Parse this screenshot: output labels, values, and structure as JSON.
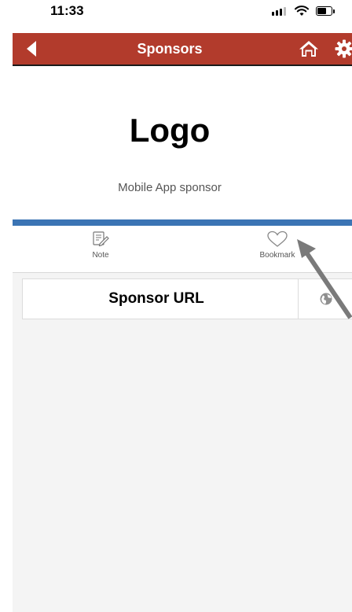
{
  "status_bar": {
    "time": "11:33"
  },
  "nav": {
    "title": "Sponsors"
  },
  "hero": {
    "logo_text": "Logo",
    "subtitle": "Mobile App sponsor"
  },
  "actions": {
    "note_label": "Note",
    "bookmark_label": "Bookmark"
  },
  "sponsor_url": {
    "label": "Sponsor URL"
  },
  "colors": {
    "nav_background": "#b23b2c",
    "divider_blue": "#3b74b4",
    "content_background": "#f4f4f4",
    "annotation_arrow": "#7a7a7a"
  },
  "icons": [
    "back-arrow-icon",
    "home-icon",
    "gear-icon",
    "note-icon",
    "heart-icon",
    "globe-icon"
  ]
}
